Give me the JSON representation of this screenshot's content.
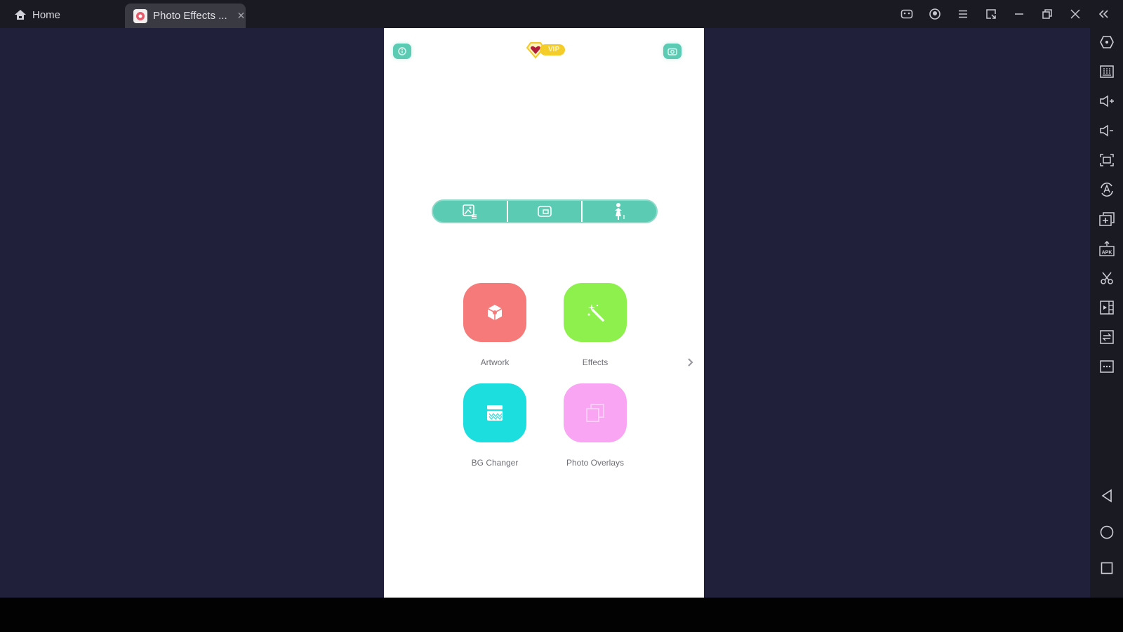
{
  "titlebar": {
    "home_tab_label": "Home",
    "active_tab_label": "Photo Effects ...",
    "home_icon": "home-icon",
    "tab_close_icon": "close-icon",
    "controls": [
      {
        "name": "gamepad-icon"
      },
      {
        "name": "account-icon"
      },
      {
        "name": "menu-icon"
      },
      {
        "name": "resize-window-icon"
      },
      {
        "name": "minimize-icon"
      },
      {
        "name": "restore-icon"
      },
      {
        "name": "close-window-icon"
      },
      {
        "name": "collapse-sidebar-icon"
      }
    ]
  },
  "sidebar": {
    "tools": [
      "settings-hexagon-icon",
      "keyboard-icon",
      "volume-up-icon",
      "volume-down-icon",
      "fullscreen-icon",
      "rotate-auto-icon",
      "multi-instance-icon",
      "install-apk-icon",
      "screenshot-cut-icon",
      "screen-record-icon",
      "sync-icon",
      "more-icon"
    ],
    "nav": [
      "back-icon",
      "home-circle-icon",
      "recents-icon"
    ]
  },
  "app": {
    "top_left_icon": "info-icon",
    "top_right_icon": "camera-icon",
    "vip_label": "VIP",
    "segments": [
      "gallery-edit-icon",
      "picture-in-picture-icon",
      "person-figure-icon"
    ],
    "tiles": [
      {
        "label": "Artwork",
        "color": "#f67a79",
        "icon": "artwork-cube-icon"
      },
      {
        "label": "Effects",
        "color": "#8ef04c",
        "icon": "magic-wand-icon"
      },
      {
        "label": "BG Changer",
        "color": "#1ddede",
        "icon": "bg-changer-icon"
      },
      {
        "label": "Photo Overlays",
        "color": "#f9a5f3",
        "icon": "overlay-layers-icon"
      }
    ],
    "next_page_icon": "chevron-right-icon"
  },
  "colors": {
    "accent": "#5ccbb4",
    "stage_bg": "#20203a",
    "titlebar_bg": "#1a1a23"
  }
}
